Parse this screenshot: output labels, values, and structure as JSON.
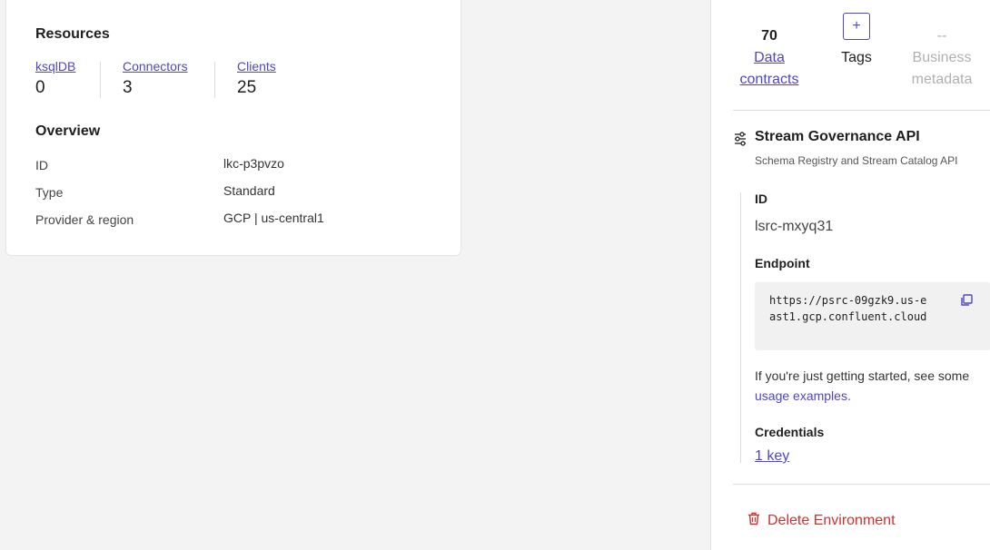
{
  "card": {
    "resources_heading": "Resources",
    "resources": [
      {
        "label": "ksqlDB",
        "value": "0"
      },
      {
        "label": "Connectors",
        "value": "3"
      },
      {
        "label": "Clients",
        "value": "25"
      }
    ],
    "overview_heading": "Overview",
    "overview": [
      {
        "label": "ID",
        "value": "lkc-p3pvzo"
      },
      {
        "label": "Type",
        "value": "Standard"
      },
      {
        "label": "Provider & region",
        "value": "GCP | us-central1"
      }
    ]
  },
  "side": {
    "stats": {
      "data_contracts": {
        "count": "70",
        "label_line1": "Data",
        "label_line2": "contracts"
      },
      "tags": {
        "button": "+",
        "label": "Tags"
      },
      "business_metadata": {
        "count": "--",
        "label_line1": "Business",
        "label_line2": "metadata"
      }
    },
    "api": {
      "title": "Stream Governance API",
      "subtitle": "Schema Registry and Stream Catalog API",
      "id_label": "ID",
      "id_value": "lsrc-mxyq31",
      "endpoint_label": "Endpoint",
      "endpoint_value": "https://psrc-09gzk9.us-east1.gcp.confluent.cloud",
      "hint_text": "If you're just getting started, see some",
      "hint_link": "usage examples.",
      "credentials_label": "Credentials",
      "credentials_link": "1 key"
    },
    "delete_label": "Delete Environment"
  },
  "colors": {
    "accent": "#4f46c8",
    "danger": "#d0312d"
  },
  "icons": {
    "api": "sliders-icon",
    "copy": "copy-icon",
    "delete": "trash-icon"
  }
}
